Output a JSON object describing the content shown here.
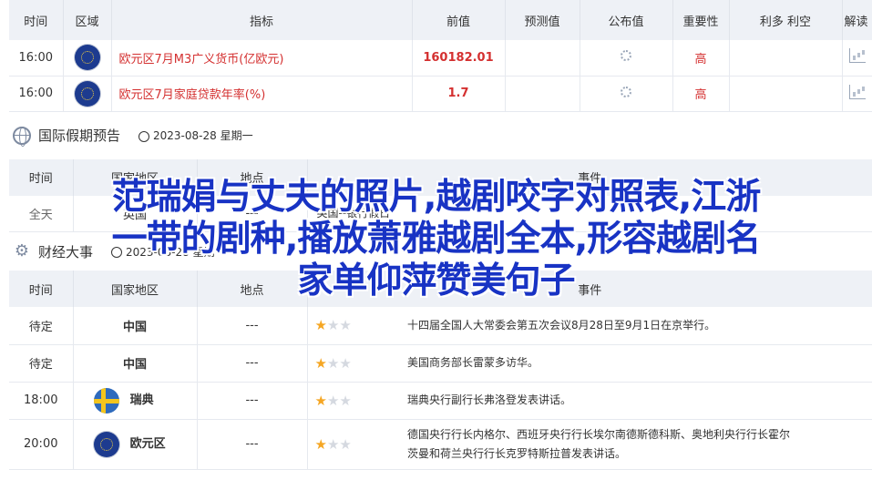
{
  "calendar": {
    "headers": [
      "时间",
      "区域",
      "指标",
      "前值",
      "预测值",
      "公布值",
      "重要性",
      "利多 利空",
      "解读"
    ],
    "rows": [
      {
        "time": "16:00",
        "region_icon": "eu-flag-icon",
        "indicator": "欧元区7月M3广义货币(亿欧元)",
        "prev": "160182.01",
        "forecast": "",
        "actual_icon": "loading-spinner-icon",
        "importance": "高",
        "bull_bear": "",
        "analysis_icon": "chart-icon"
      },
      {
        "time": "16:00",
        "region_icon": "eu-flag-icon",
        "indicator": "欧元区7月家庭贷款年率(%)",
        "prev": "1.7",
        "forecast": "",
        "actual_icon": "loading-spinner-icon",
        "importance": "高",
        "bull_bear": "",
        "analysis_icon": "chart-icon"
      }
    ]
  },
  "holidays": {
    "title": "国际假期预告",
    "date": "2023-08-28 星期一",
    "headers": [
      "时间",
      "国家地区",
      "地点",
      "事件"
    ],
    "row": {
      "time": "全天",
      "country": "英国",
      "place": "---",
      "event": "英国--银行假日"
    }
  },
  "events": {
    "title": "财经大事",
    "date": "2023-08-28 星期一",
    "headers": [
      "时间",
      "国家地区",
      "地点",
      "事件"
    ],
    "rows": [
      {
        "time": "待定",
        "country": "中国",
        "place": "---",
        "stars": 1,
        "event": "十四届全国人大常委会第五次会议8月28日至9月1日在京举行。"
      },
      {
        "time": "待定",
        "country": "中国",
        "place": "---",
        "stars": 1,
        "event": "美国商务部长雷蒙多访华。"
      },
      {
        "time": "18:00",
        "country": "瑞典",
        "place": "---",
        "stars": 1,
        "event": "瑞典央行副行长弗洛登发表讲话。",
        "flag": "sweden-flag-icon"
      },
      {
        "time": "20:00",
        "country": "欧元区",
        "place": "---",
        "stars": 1,
        "event_line1": "德国央行行长内格尔、西班牙央行行长埃尔南德斯德科斯、奥地利央行行长霍尔",
        "event_line2": "茨曼和荷兰央行行长克罗特斯拉普发表讲话。",
        "flag": "eu-flag-icon"
      }
    ]
  },
  "overlay": {
    "line1": "范瑞娟与丈夫的照片,越剧咬字对照表,江浙",
    "line2": "一带的剧种,播放萧雅越剧全本,形容越剧名",
    "line3": "家单仰萍赞美句子"
  },
  "colors": {
    "accent_red": "#d43030",
    "header_bg": "#eef1f6",
    "overlay_blue": "#1833c4",
    "star": "#f5a623"
  }
}
